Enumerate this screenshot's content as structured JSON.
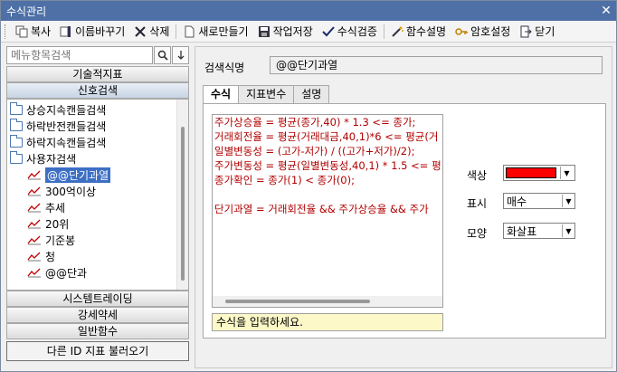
{
  "window": {
    "title": "수식관리"
  },
  "toolbar": {
    "buttons": [
      {
        "label": "복사",
        "icon": "copy-icon"
      },
      {
        "label": "이름바꾸기",
        "icon": "rename-icon"
      },
      {
        "label": "삭제",
        "icon": "delete-icon"
      },
      {
        "label": "새로만들기",
        "icon": "new-icon"
      },
      {
        "label": "작업저장",
        "icon": "save-icon"
      },
      {
        "label": "수식검증",
        "icon": "check-icon"
      },
      {
        "label": "함수설명",
        "icon": "wand-icon"
      },
      {
        "label": "암호설정",
        "icon": "key-icon"
      },
      {
        "label": "닫기",
        "icon": "close-door-icon"
      }
    ]
  },
  "left_panel": {
    "search_placeholder": "메뉴항목검색",
    "categories_top": [
      "기술적지표",
      "신호검색"
    ],
    "tree": {
      "folders": [
        "상승지속캔들검색",
        "하락반전캔들검색",
        "하락지속캔들검색",
        "사용자검색"
      ],
      "items": [
        "@@단기과열",
        "300억이상",
        "추세",
        "20위",
        "기준봉",
        "청",
        "@@단과"
      ],
      "selected": "@@단기과열"
    },
    "categories_bottom": [
      "시스템트레이딩",
      "강세약세",
      "일반함수"
    ],
    "load_button": "다른 ID 지표 불러오기"
  },
  "right_panel": {
    "formula_name_label": "검색식명",
    "formula_name": "@@단기과열",
    "tabs": [
      "수식",
      "지표변수",
      "설명"
    ],
    "active_tab": "수식",
    "code_lines": [
      "주가상승율 = 평균(종가,40) * 1.3 <= 종가;",
      "거래회전율 = 평균(거래대금,40,1)*6 <= 평균(거",
      "일별변동성 = (고가-저가) / ((고가+저가)/2);",
      "주가변동성 = 평균(일별변동성,40,1) * 1.5 <= 평",
      "종가확인 = 종가(1) < 종가(0);",
      "",
      "단기과열 = 거래회전율 && 주가상승율 && 주가"
    ],
    "hint": "수식을 입력하세요.",
    "props": {
      "color_label": "색상",
      "color_value": "#ff0000",
      "display_label": "표시",
      "display_value": "매수",
      "shape_label": "모양",
      "shape_value": "화살표"
    }
  }
}
